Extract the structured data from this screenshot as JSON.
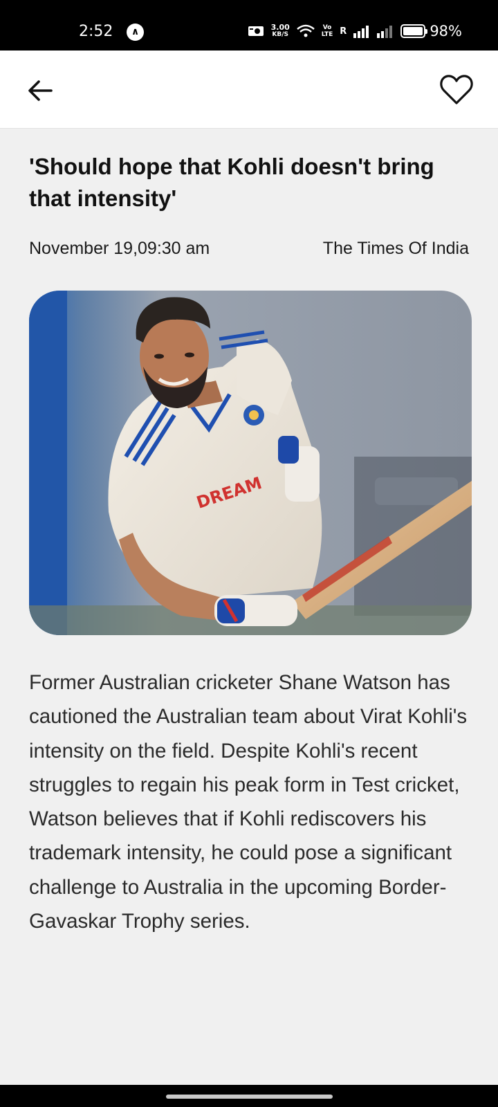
{
  "status_bar": {
    "time": "2:52",
    "network_speed_value": "3.00",
    "network_speed_unit": "KB/S",
    "volte_top": "Vo",
    "volte_bottom": "LTE",
    "roaming": "R",
    "battery_percent_text": "98%",
    "battery_level": 0.98
  },
  "app_bar": {
    "back_icon": "arrow-left-icon",
    "favorite_icon": "heart-outline-icon"
  },
  "article": {
    "title": "'Should hope that Kohli doesn't bring that intensity'",
    "date": "November 19,09:30 am",
    "source": "The Times Of India",
    "image_description_icon": "article-photo",
    "body": "Former Australian cricketer Shane Watson has cautioned the Australian team about Virat Kohli's intensity on the field. Despite Kohli's recent struggles to regain his peak form in Test cricket, Watson believes that if Kohli rediscovers his trademark intensity, he could pose a significant challenge to Australia in the upcoming Border-Gavaskar Trophy series.",
    "image_text": "DREAM"
  },
  "colors": {
    "background": "#f0f0f0",
    "app_bar": "#ffffff",
    "status_bar": "#000000",
    "text": "#1c1c1c"
  }
}
